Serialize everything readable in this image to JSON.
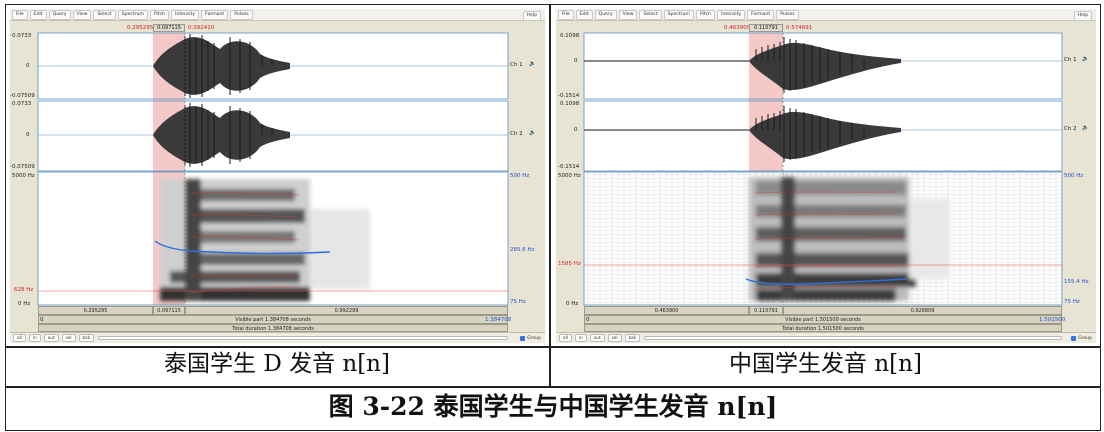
{
  "menu": [
    "File",
    "Edit",
    "Query",
    "View",
    "Select",
    "Spectrum",
    "Pitch",
    "Intensity",
    "Formant",
    "Pulses"
  ],
  "help": "Help",
  "buttons": [
    "all",
    "in",
    "out",
    "sel",
    "bak"
  ],
  "group_label": "Group",
  "left": {
    "sel_start": "0.295295",
    "sel_dur": "0.097115",
    "sel_end": "0.392410",
    "amp_top_1": "0.0733",
    "amp_zero_1": "0",
    "amp_bot_1": "-0.07509",
    "amp_top_2": "0.0733",
    "amp_zero_2": "0",
    "amp_bot_2": "-0.07509",
    "ch1": "Ch 1",
    "ch2": "Ch 2",
    "freq_top": "5000 Hz",
    "freq_mark": "628 Hz",
    "freq_bottom": "0 Hz",
    "pitch_top": "500 Hz",
    "pitch_cursor": "285.6 Hz",
    "pitch_bottom": "75 Hz",
    "t_before": "0.295295",
    "t_sel": "0.097115",
    "t_after": "0.992299",
    "vis_start": "0",
    "visible": "Visible part 1.384708 seconds",
    "vis_end": "1.384708",
    "total": "Total duration 1.384708 seconds"
  },
  "right": {
    "sel_start": "0.463900",
    "sel_dur": "0.110791",
    "sel_end": "0.574691",
    "amp_top_1": "0.1098",
    "amp_zero_1": "0",
    "amp_bot_1": "-0.1514",
    "amp_top_2": "0.1098",
    "amp_zero_2": "0",
    "amp_bot_2": "-0.1514",
    "ch1": "Ch 1",
    "ch2": "Ch 2",
    "freq_top": "5000 Hz",
    "freq_mark": "1585 Hz",
    "freq_bottom": "0 Hz",
    "pitch_top": "500 Hz",
    "pitch_cursor": "155.4 Hz",
    "pitch_bottom": "75 Hz",
    "t_before": "0.463900",
    "t_sel": "0.110791",
    "t_after": "0.926809",
    "vis_start": "0",
    "visible": "Visible part 1.501500 seconds",
    "vis_end": "1.501500",
    "total": "Total duration 1.501500 seconds"
  },
  "captions": {
    "left": "泰国学生 D 发音 n[n]",
    "right": "中国学生发音 n[n]",
    "figure": "图 3-22 泰国学生与中国学生发音 n[n]"
  },
  "colors": {
    "selection": "#f6c9c9",
    "pitch": "#2d6fe0",
    "formant": "#e03030",
    "cursor": "#e05050",
    "panel_bg": "#e8e4d4"
  }
}
